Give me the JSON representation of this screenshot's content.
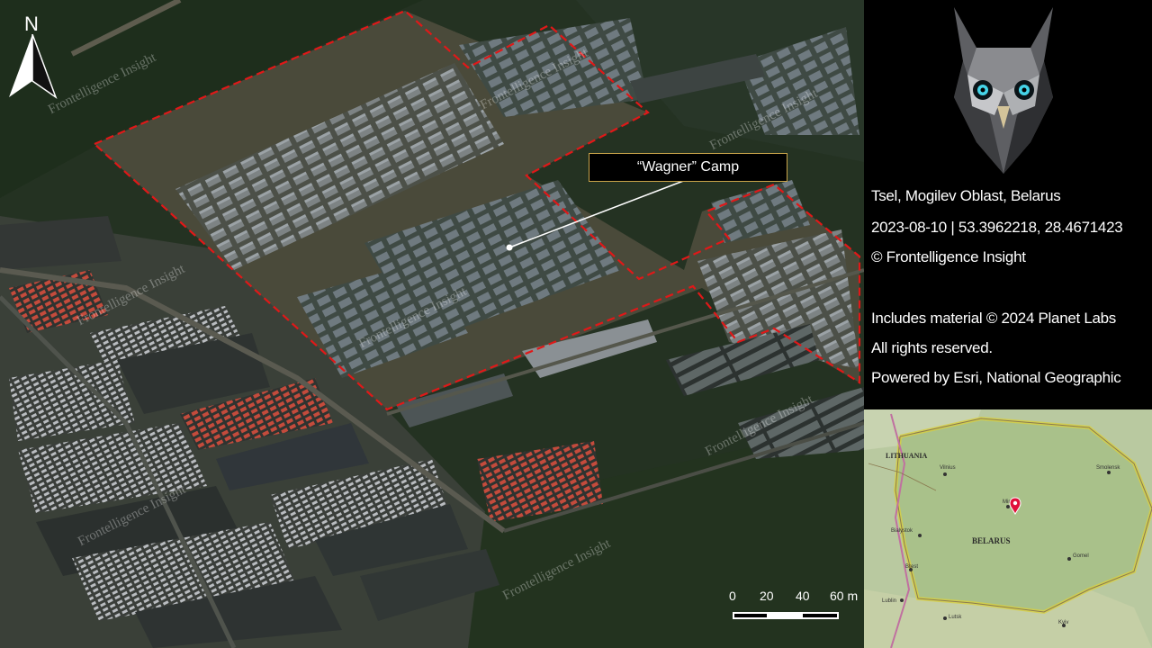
{
  "north_arrow": {
    "label": "N"
  },
  "callout": {
    "label": "“Wagner” Camp"
  },
  "watermarks": [
    "Frontelligence Insight",
    "Frontelligence Insight",
    "Frontelligence Insight",
    "Frontelligence Insight",
    "Frontelligence Insight",
    "Frontelligence Insight",
    "Frontelligence Insight",
    "Frontelligence Insight",
    "Frontelligence Insight",
    "Frontelligence Insight",
    "Frontelligence Insight"
  ],
  "info": {
    "location": "Tsel, Mogilev Oblast, Belarus",
    "date_coords": "2023-08-10  | 53.3962218,  28.4671423",
    "copyright": "© Frontelligence Insight",
    "credit_1": "Includes material © 2024 Planet Labs",
    "credit_2": "All rights reserved.",
    "credit_3": "Powered by Esri, National Geographic"
  },
  "scale": {
    "labels": [
      "0",
      "20",
      "40",
      "60 m"
    ]
  },
  "inset_map": {
    "labels": {
      "lithuania": "LITHUANIA",
      "belarus": "BELARUS",
      "vilnius": "Vilnius",
      "minsk": "Minsk",
      "smolensk": "Smolensk",
      "bialystok": "Bialystok",
      "brest": "Brest",
      "gomel": "Gomel",
      "lublin": "Lublin",
      "lutsk": "Lutsk",
      "kyiv": "Kyiv"
    },
    "marker_color": "#e0103a"
  },
  "colors": {
    "boundary": "#e01818",
    "callout_border": "#c9a44a"
  }
}
